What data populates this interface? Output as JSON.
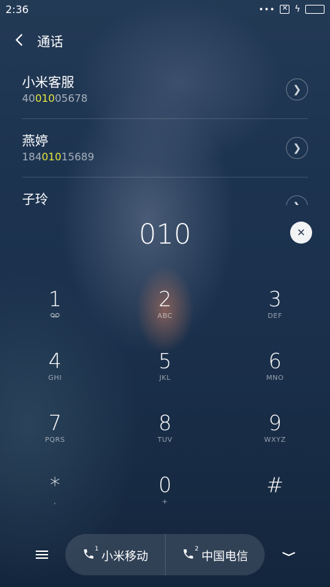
{
  "status_bar": {
    "time": "2:36",
    "dots": "•••"
  },
  "header": {
    "title": "通话"
  },
  "contacts": [
    {
      "name": "小米客服",
      "number_pre": "40",
      "number_match": "010",
      "number_post": "05678"
    },
    {
      "name": "燕婷",
      "number_pre": "184",
      "number_match": "010",
      "number_post": "15689"
    },
    {
      "name": "子玲",
      "number_pre": "",
      "number_match": "",
      "number_post": ""
    }
  ],
  "dialed_number": "010",
  "keypad": [
    {
      "digit": "1",
      "letters": ""
    },
    {
      "digit": "2",
      "letters": "ABC"
    },
    {
      "digit": "3",
      "letters": "DEF"
    },
    {
      "digit": "4",
      "letters": "GHI"
    },
    {
      "digit": "5",
      "letters": "JKL"
    },
    {
      "digit": "6",
      "letters": "MNO"
    },
    {
      "digit": "7",
      "letters": "PQRS"
    },
    {
      "digit": "8",
      "letters": "TUV"
    },
    {
      "digit": "9",
      "letters": "WXYZ"
    },
    {
      "digit": "*",
      "letters": ","
    },
    {
      "digit": "0",
      "letters": "+"
    },
    {
      "digit": "#",
      "letters": ""
    }
  ],
  "bottom_bar": {
    "sim1": {
      "label": "小米移动",
      "index": "1"
    },
    "sim2": {
      "label": "中国电信",
      "index": "2"
    }
  },
  "colors": {
    "match_highlight": "#e6e63c",
    "clear_button_bg": "#f2f3f5"
  },
  "icons": [
    "more-dots-icon",
    "sim-disabled-icon",
    "charging-icon",
    "battery-icon",
    "back-arrow-icon",
    "chevron-right-icon",
    "voicemail-icon",
    "clear-icon",
    "menu-icon",
    "phone-icon",
    "collapse-keypad-icon"
  ]
}
